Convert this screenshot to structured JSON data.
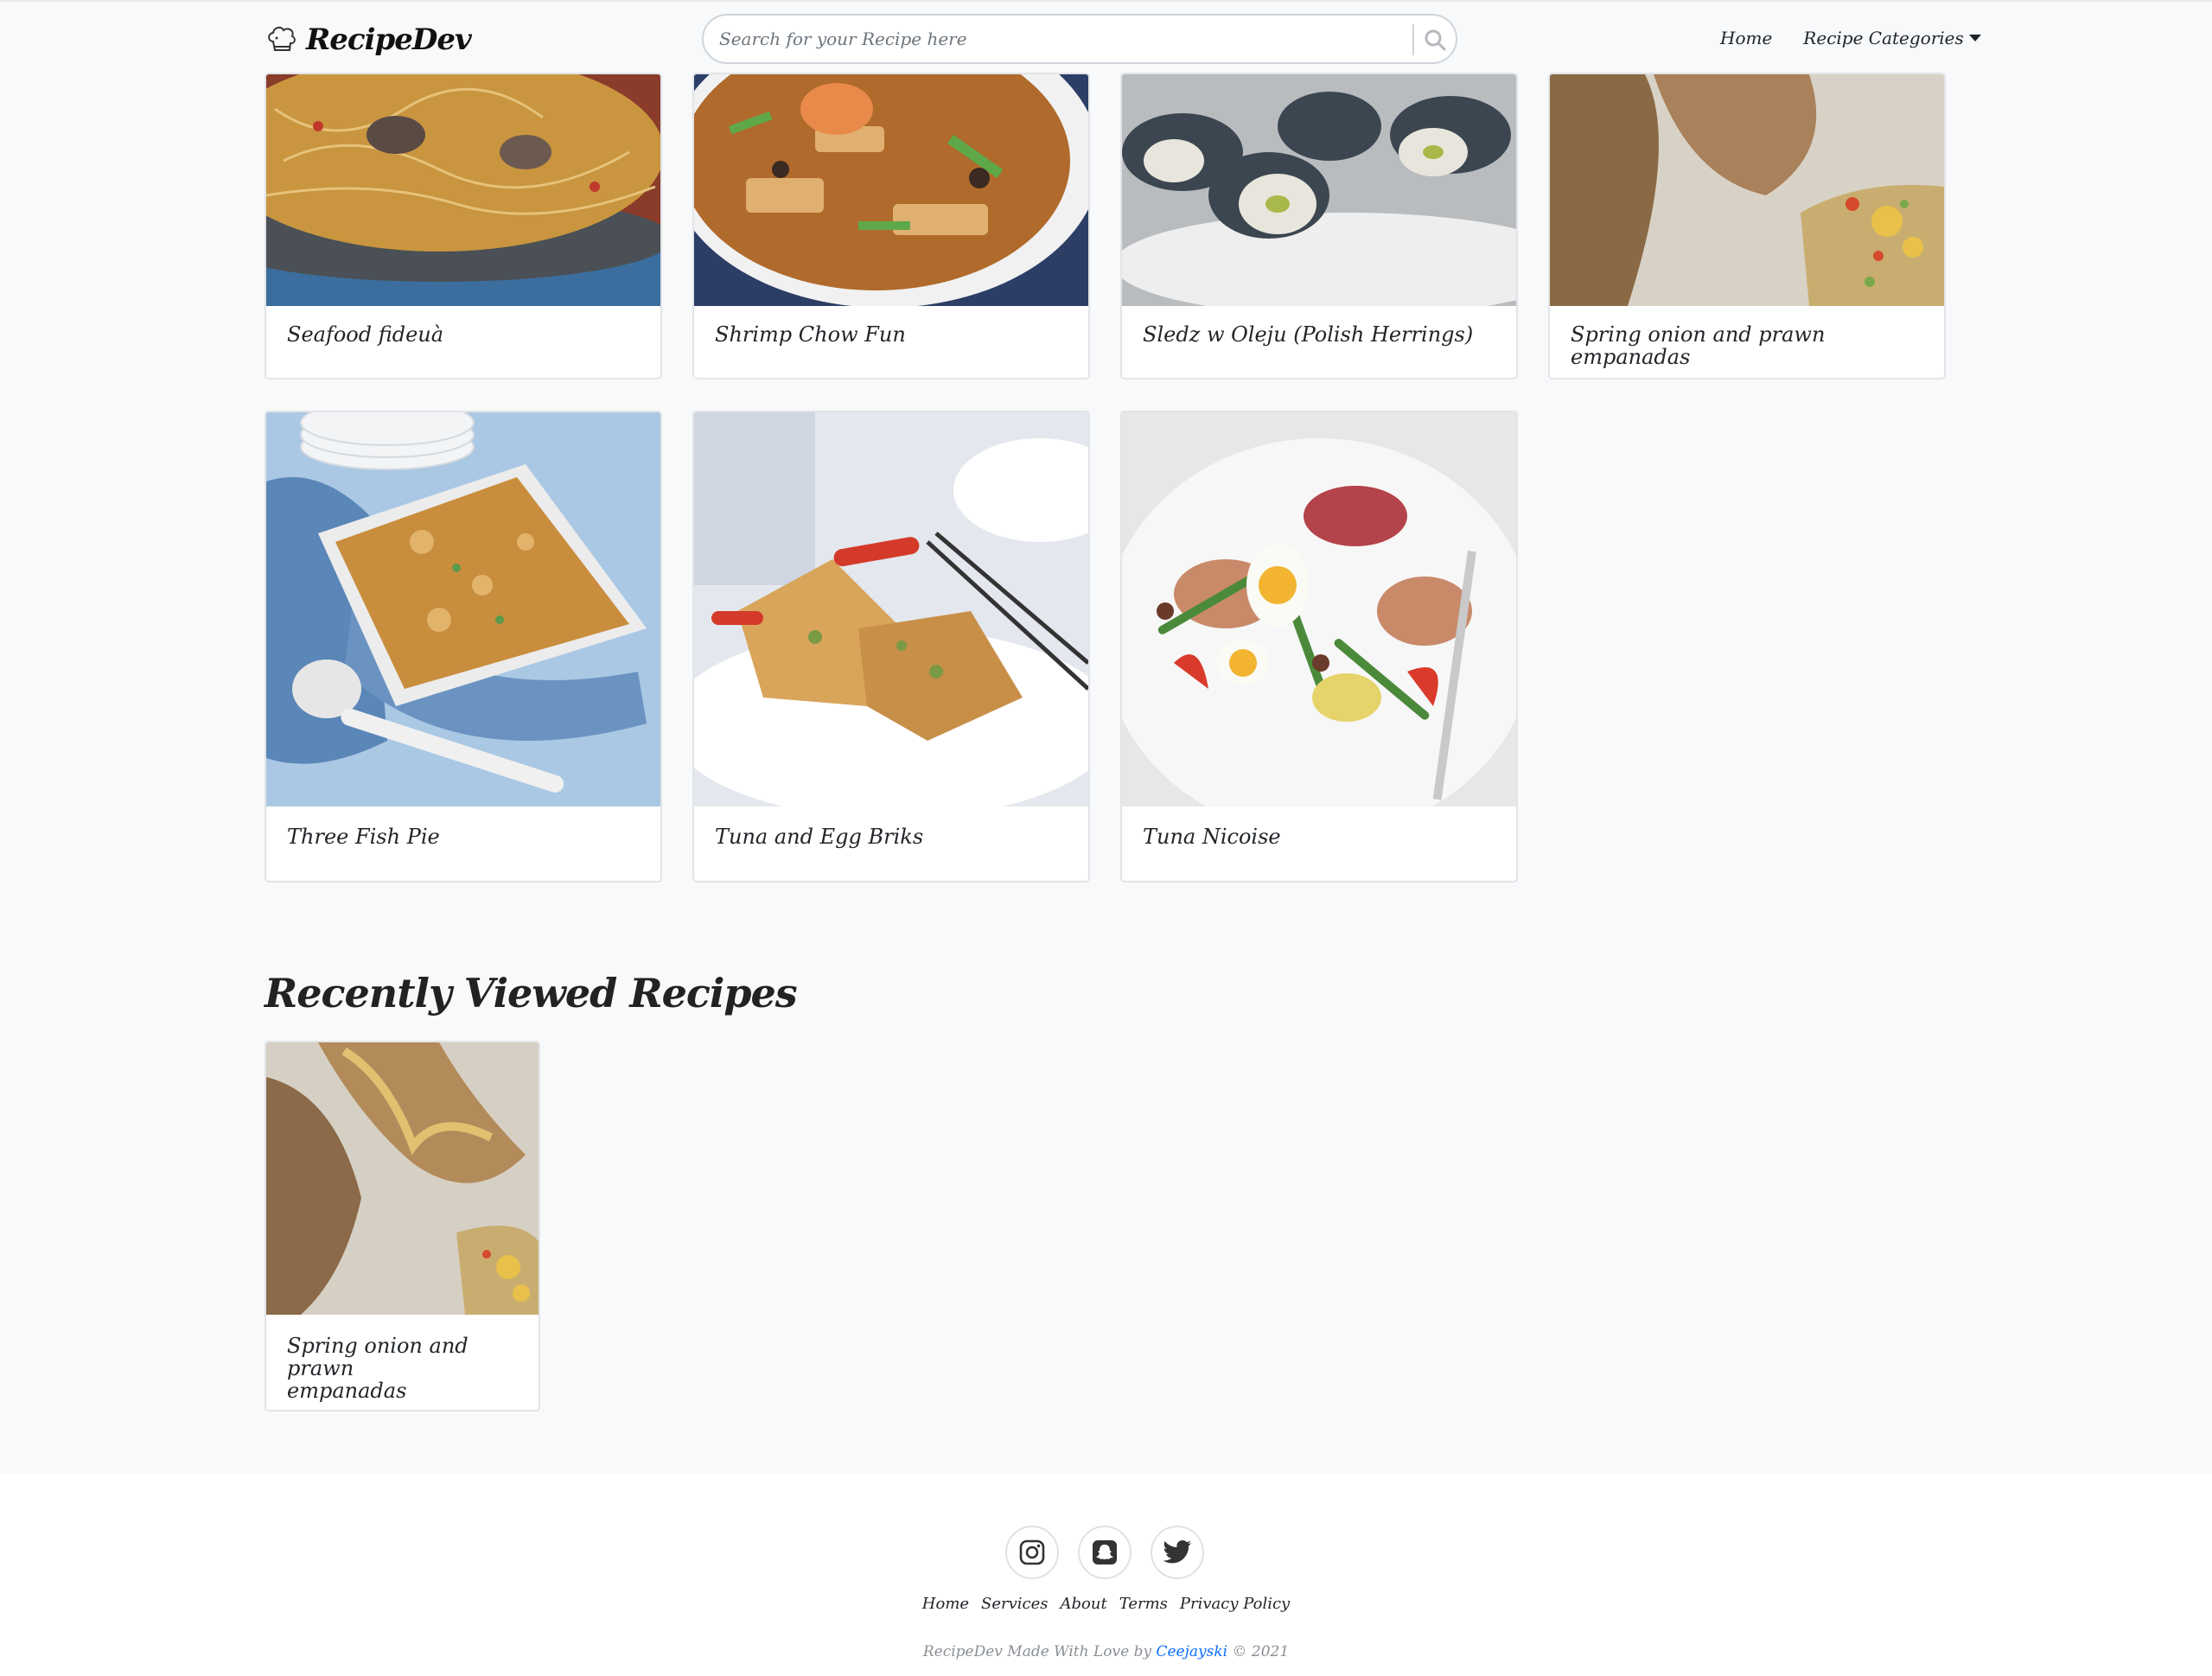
{
  "header": {
    "brand": "RecipeDev",
    "search_placeholder": "Search for your Recipe here",
    "nav": [
      {
        "label": "Home"
      },
      {
        "label": "Recipe Categories"
      }
    ]
  },
  "recipes": [
    {
      "title": "Seafood fideuà"
    },
    {
      "title": "Shrimp Chow Fun"
    },
    {
      "title": "Sledz w Oleju (Polish Herrings)"
    },
    {
      "title": "Spring onion and prawn empanadas"
    },
    {
      "title": "Three Fish Pie"
    },
    {
      "title": "Tuna and Egg Briks"
    },
    {
      "title": "Tuna Nicoise"
    }
  ],
  "recently_viewed": {
    "heading": "Recently Viewed Recipes",
    "items": [
      {
        "title_line1": "Spring onion and prawn",
        "title_line2": "empanadas"
      }
    ]
  },
  "footer": {
    "social": [
      "instagram-icon",
      "snapchat-icon",
      "twitter-icon"
    ],
    "links": [
      "Home",
      "Services",
      "About",
      "Terms",
      "Privacy Policy"
    ],
    "copyright_prefix": "RecipeDev Made With Love by",
    "author": "Ceejayski",
    "copyright_suffix": "© 2021"
  }
}
